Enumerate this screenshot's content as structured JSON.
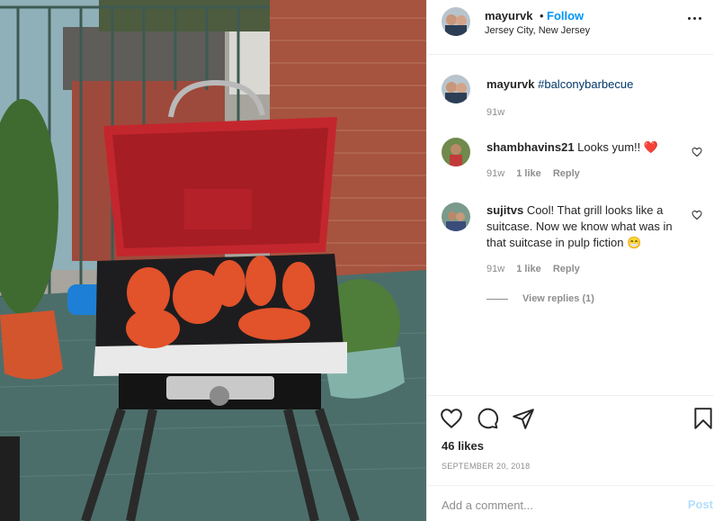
{
  "post": {
    "author": "mayurvk",
    "separator": "•",
    "follow_label": "Follow",
    "location": "Jersey City, New Jersey"
  },
  "caption": {
    "username": "mayurvk",
    "hashtag": "#balconybarbecue",
    "time": "91w"
  },
  "comments": [
    {
      "username": "shambhavins21",
      "text": "Looks yum!!",
      "emoji": "❤️",
      "time": "91w",
      "likes": "1 like",
      "reply_label": "Reply"
    },
    {
      "username": "sujitvs",
      "text": "Cool! That grill looks like a suitcase. Now we know what was in that suitcase in pulp fiction",
      "emoji": "😁",
      "time": "91w",
      "likes": "1 like",
      "reply_label": "Reply"
    }
  ],
  "view_replies_label": "View replies (1)",
  "actions": {
    "icons": [
      "heart-icon",
      "comment-icon",
      "share-icon",
      "bookmark-icon"
    ]
  },
  "likes_label": "46 likes",
  "date": "SEPTEMBER 20, 2018",
  "add_comment": {
    "placeholder": "Add a comment...",
    "post_label": "Post"
  },
  "colors": {
    "follow": "#0095f6",
    "hashtag": "#00376b",
    "muted": "#8e8e8e",
    "heart_emoji": "#ed4956",
    "post_disabled": "#b2dffc"
  }
}
